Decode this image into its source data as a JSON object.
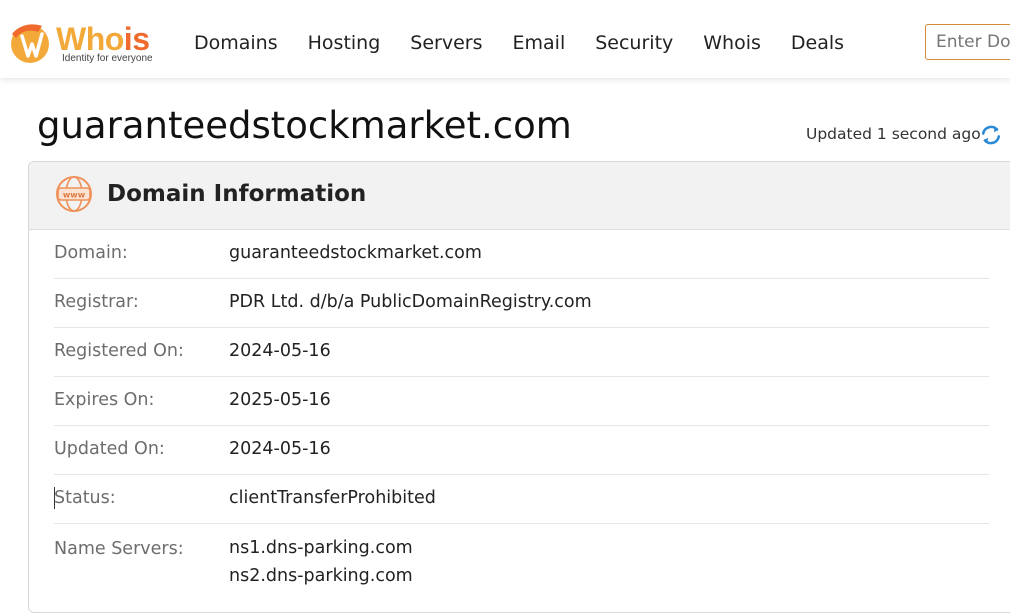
{
  "header": {
    "logo": {
      "word_main": "Who",
      "word_accent": "is",
      "tagline": "Identity for everyone",
      "colors": {
        "primary": "#f3a93a",
        "accent": "#f06a2d"
      }
    },
    "nav": [
      {
        "label": "Domains"
      },
      {
        "label": "Hosting"
      },
      {
        "label": "Servers"
      },
      {
        "label": "Email"
      },
      {
        "label": "Security"
      },
      {
        "label": "Whois"
      },
      {
        "label": "Deals"
      }
    ],
    "search": {
      "placeholder": "Enter Domain or IP",
      "value": ""
    }
  },
  "page": {
    "domain_title": "guaranteedstockmarket.com",
    "updated_text": "Updated 1 second ago",
    "refresh_icon": "refresh-icon"
  },
  "card": {
    "icon": "www-globe-icon",
    "title": "Domain Information",
    "rows": [
      {
        "label": "Domain:",
        "value": "guaranteedstockmarket.com"
      },
      {
        "label": "Registrar:",
        "value": "PDR Ltd. d/b/a PublicDomainRegistry.com"
      },
      {
        "label": "Registered On:",
        "value": "2024-05-16"
      },
      {
        "label": "Expires On:",
        "value": "2025-05-16"
      },
      {
        "label": "Updated On:",
        "value": "2024-05-16"
      },
      {
        "label": "Status:",
        "value": "clientTransferProhibited"
      }
    ],
    "name_servers": {
      "label": "Name Servers:",
      "values": [
        "ns1.dns-parking.com",
        "ns2.dns-parking.com"
      ]
    }
  },
  "colors": {
    "accent": "#f06a2d",
    "refresh": "#2a8ad6",
    "label_gray": "#6d6d6d"
  }
}
